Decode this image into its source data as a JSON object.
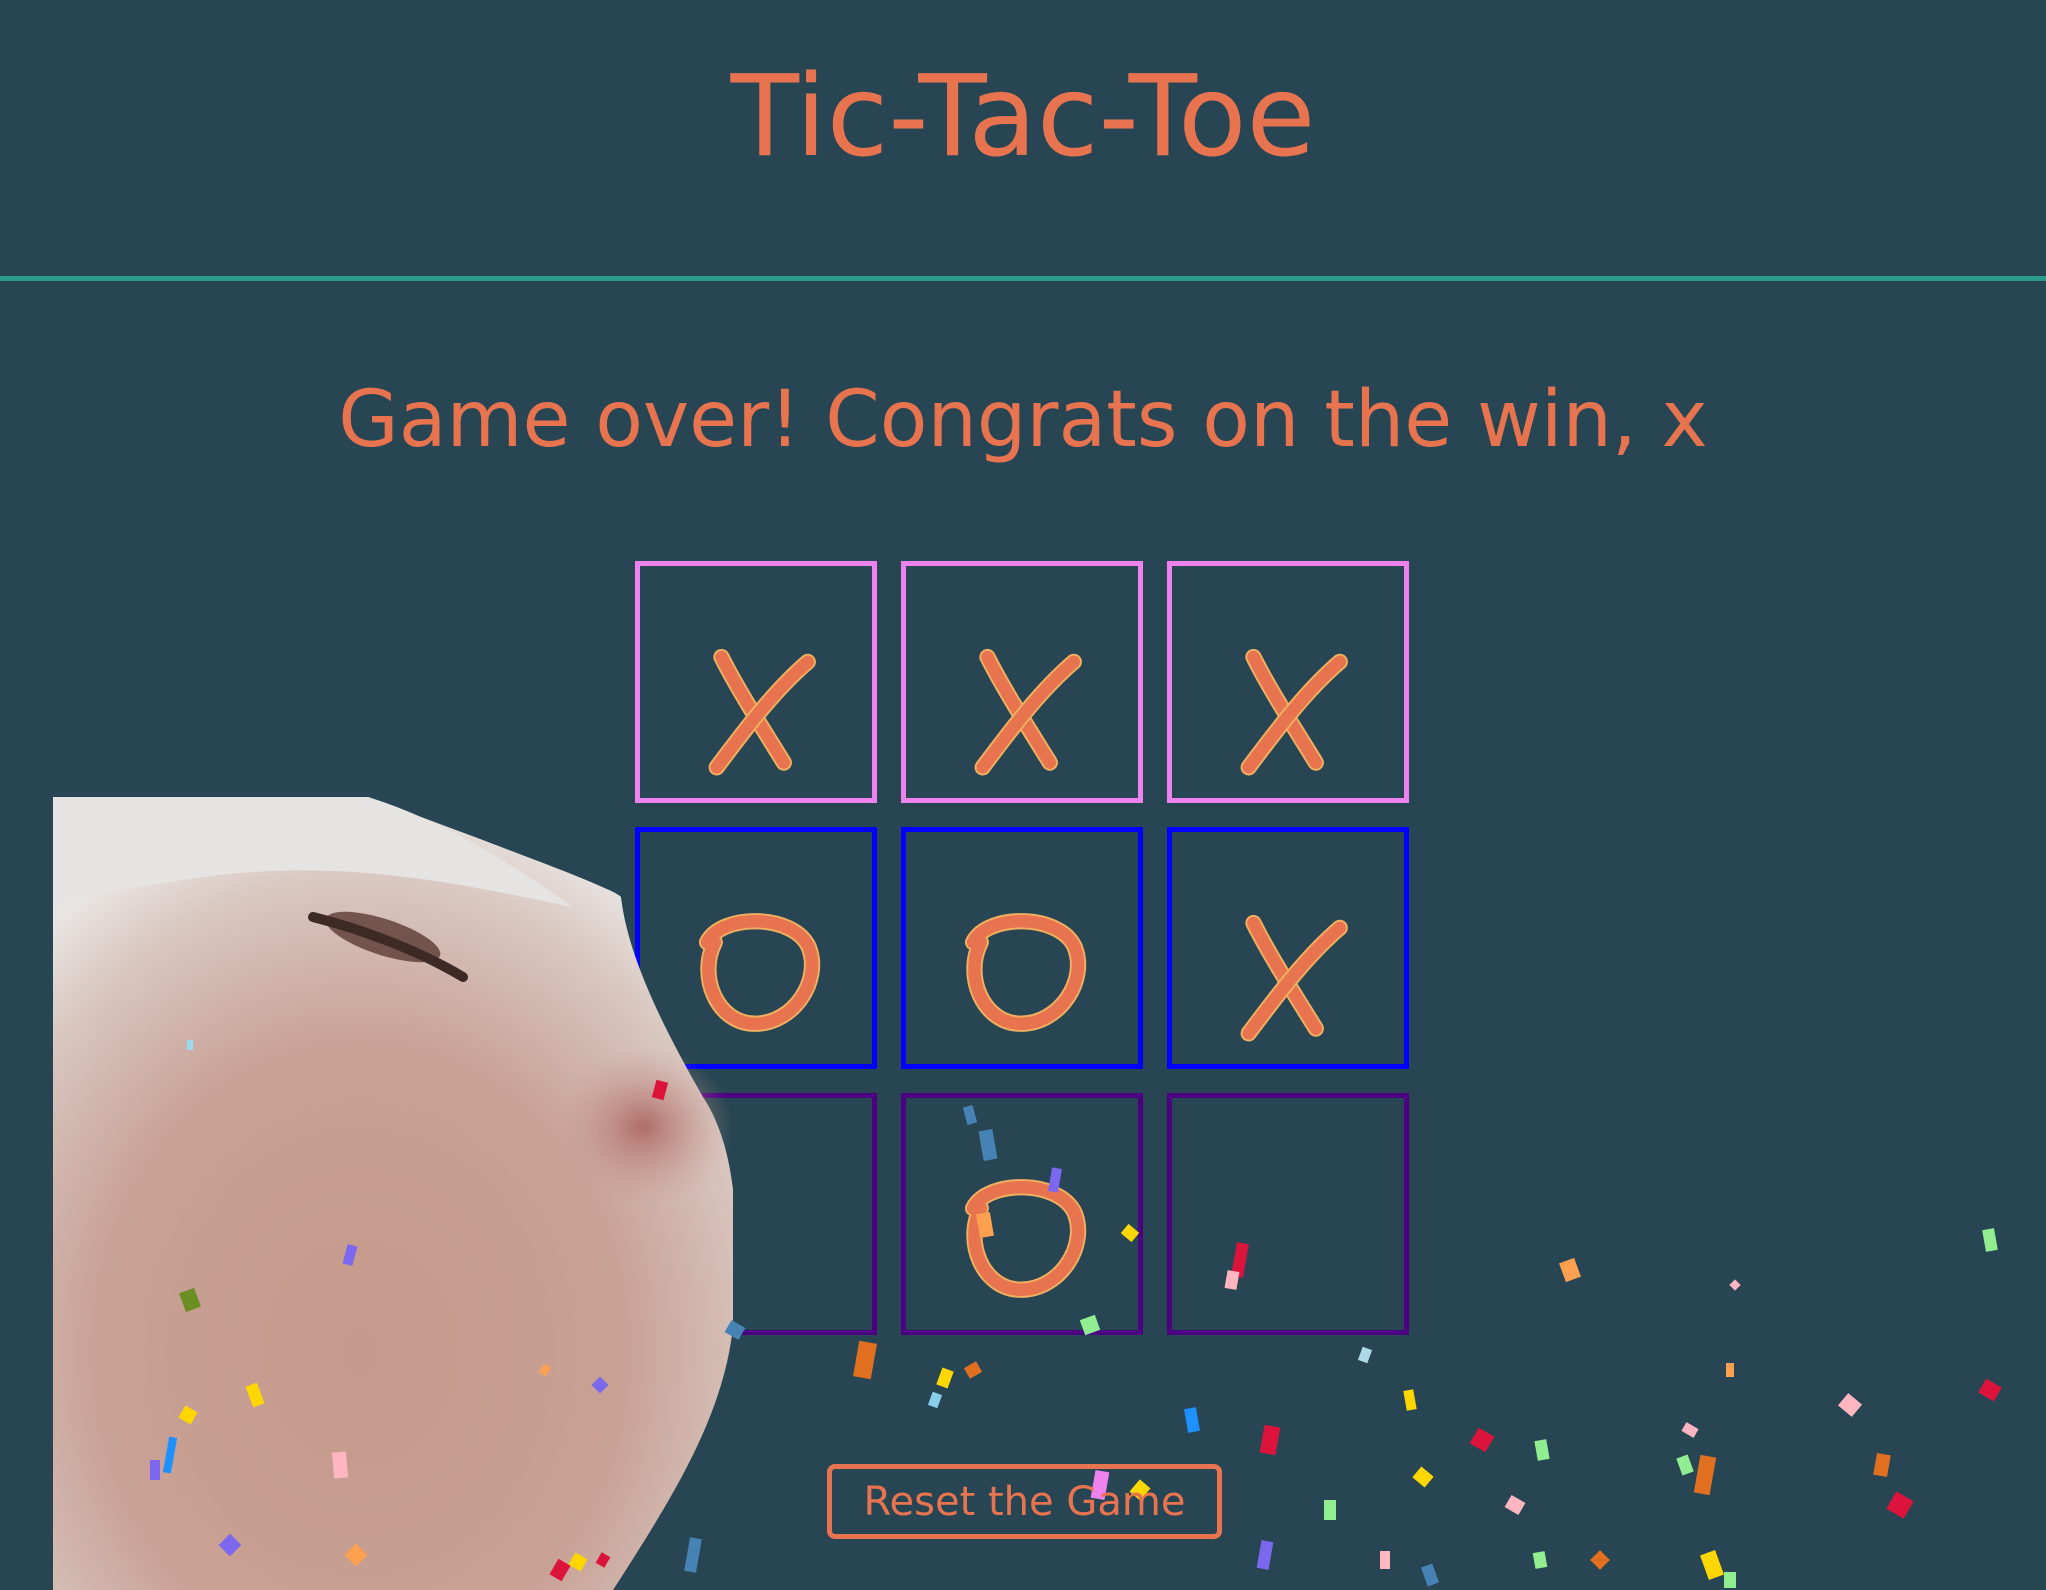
{
  "app": {
    "title": "Tic-Tac-Toe",
    "status": "Game over! Congrats on the win, x",
    "reset_label": "Reset the Game"
  },
  "board": {
    "cells": [
      "X",
      "X",
      "X",
      "O",
      "O",
      "X",
      "",
      "O",
      ""
    ],
    "winner": "x"
  },
  "colors": {
    "background": "#274553",
    "accent": "#e8744f",
    "divider": "#2a9d8f",
    "row_borders": [
      "#ee82ee",
      "#0000ff",
      "#4b0082"
    ]
  },
  "overlay": {
    "image": "cat-face",
    "effect": "confetti"
  }
}
